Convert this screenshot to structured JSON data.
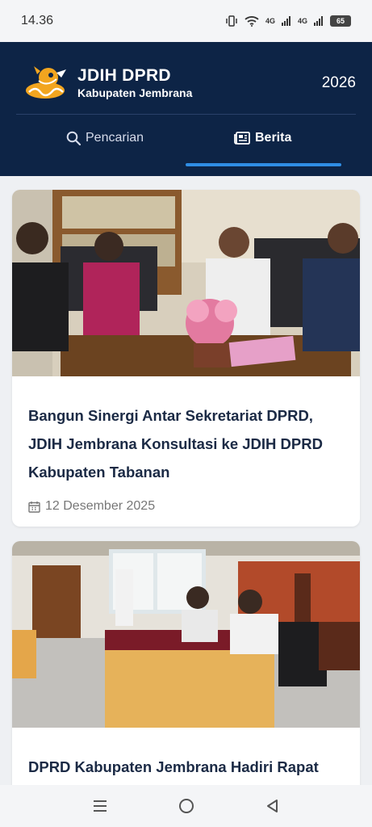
{
  "status_bar": {
    "time": "14.36",
    "signal1": "4G",
    "signal2": "4G",
    "battery": "65"
  },
  "header": {
    "title": "JDIH DPRD",
    "subtitle": "Kabupaten Jembrana",
    "year": "2026",
    "tabs": [
      {
        "label": "Pencarian",
        "icon": "search-icon",
        "active": false
      },
      {
        "label": "Berita",
        "icon": "newspaper-icon",
        "active": true
      }
    ],
    "accent": "#2f8de4",
    "background": "#0d2446"
  },
  "news": [
    {
      "title": "Bangun Sinergi Antar Sekretariat DPRD, JDIH Jembrana Konsultasi ke JDIH DPRD Kabupaten Tabanan",
      "date": "12 Desember 2025",
      "image": "meeting-photo"
    },
    {
      "title": "DPRD Kabupaten Jembrana Hadiri Rapat",
      "image": "council-meeting-photo"
    }
  ],
  "nav": {
    "items": [
      "menu-icon",
      "home-icon",
      "back-icon"
    ]
  }
}
